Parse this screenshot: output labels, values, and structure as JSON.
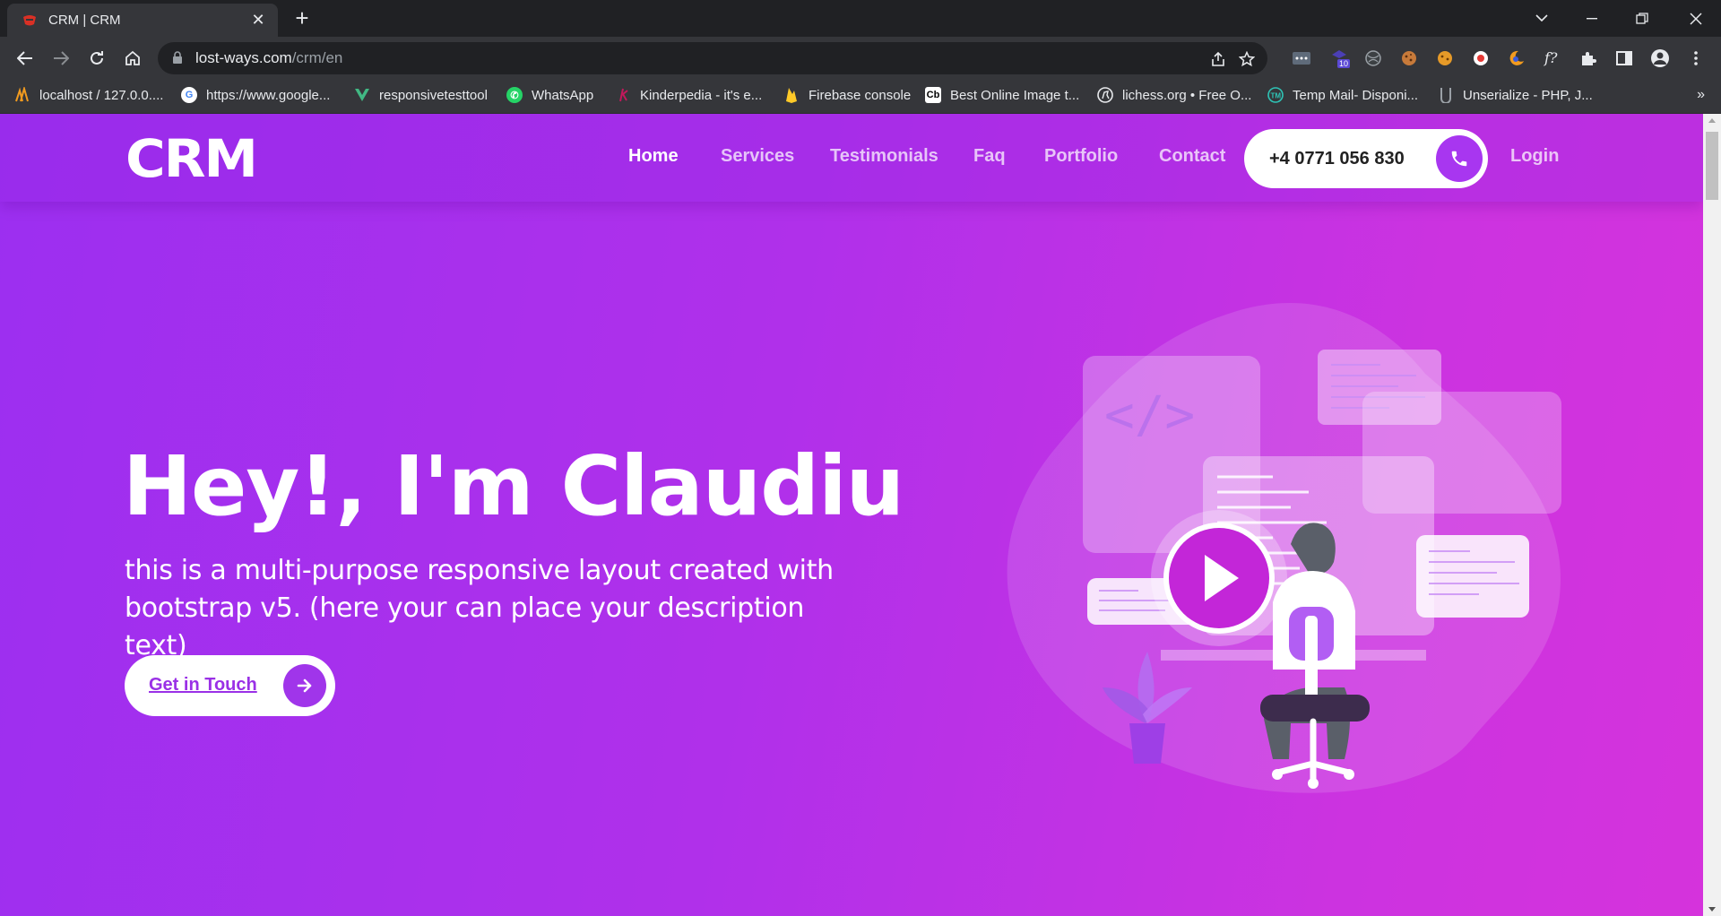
{
  "browser": {
    "tab_title": "CRM | CRM",
    "url_domain": "lost-ways.com",
    "url_path": "/crm/en",
    "extension_badge": "10"
  },
  "bookmarks": [
    {
      "label": "localhost / 127.0.0....",
      "icon": "phpmyadmin-icon"
    },
    {
      "label": "https://www.google...",
      "icon": "google-icon"
    },
    {
      "label": "responsivetesttool",
      "icon": "vue-icon"
    },
    {
      "label": "WhatsApp",
      "icon": "whatsapp-icon"
    },
    {
      "label": "Kinderpedia - it's e...",
      "icon": "kinderpedia-icon"
    },
    {
      "label": "Firebase console",
      "icon": "firebase-icon"
    },
    {
      "label": "Best Online Image t...",
      "icon": "cb-icon"
    },
    {
      "label": "lichess.org • Free O...",
      "icon": "lichess-icon"
    },
    {
      "label": "Temp Mail- Disponi...",
      "icon": "tempmail-icon"
    },
    {
      "label": "Unserialize - PHP, J...",
      "icon": "unserialize-icon"
    }
  ],
  "site": {
    "logo": "CRM",
    "menu": [
      "Home",
      "Services",
      "Testimonials",
      "Faq",
      "Portfolio",
      "Contact"
    ],
    "phone": "+4 0771 056 830",
    "login": "Login"
  },
  "hero": {
    "title": "Hey!, I'm Claudiu",
    "description": "this is a multi-purpose responsive layout created with bootstrap v5. (here your can place your description text)",
    "cta": "Get in Touch",
    "code_tag": "</>"
  },
  "colors": {
    "gradient_start": "#9c2ff0",
    "gradient_end": "#d533dc",
    "accent": "#a836f0"
  }
}
